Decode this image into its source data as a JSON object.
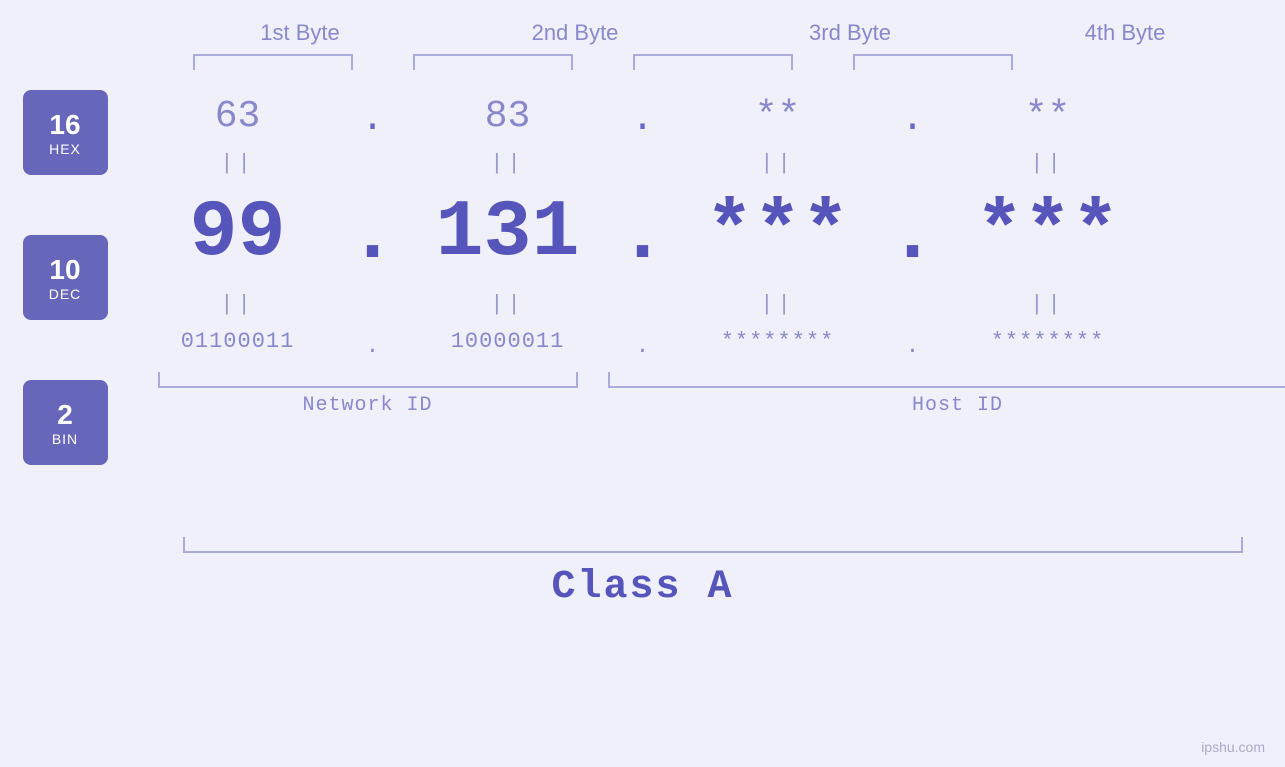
{
  "bytes": {
    "headers": [
      "1st Byte",
      "2nd Byte",
      "3rd Byte",
      "4th Byte"
    ]
  },
  "bases": [
    {
      "num": "16",
      "name": "HEX"
    },
    {
      "num": "10",
      "name": "DEC"
    },
    {
      "num": "2",
      "name": "BIN"
    }
  ],
  "hex_values": [
    "63",
    "83",
    "**",
    "**"
  ],
  "dec_values": [
    "99",
    "131",
    "***",
    "***"
  ],
  "bin_values": [
    "01100011",
    "10000011",
    "********",
    "********"
  ],
  "dots": [
    ".",
    ".",
    ".",
    ""
  ],
  "equals_symbol": "||",
  "labels": {
    "network_id": "Network ID",
    "host_id": "Host ID",
    "class": "Class A",
    "watermark": "ipshu.com"
  }
}
